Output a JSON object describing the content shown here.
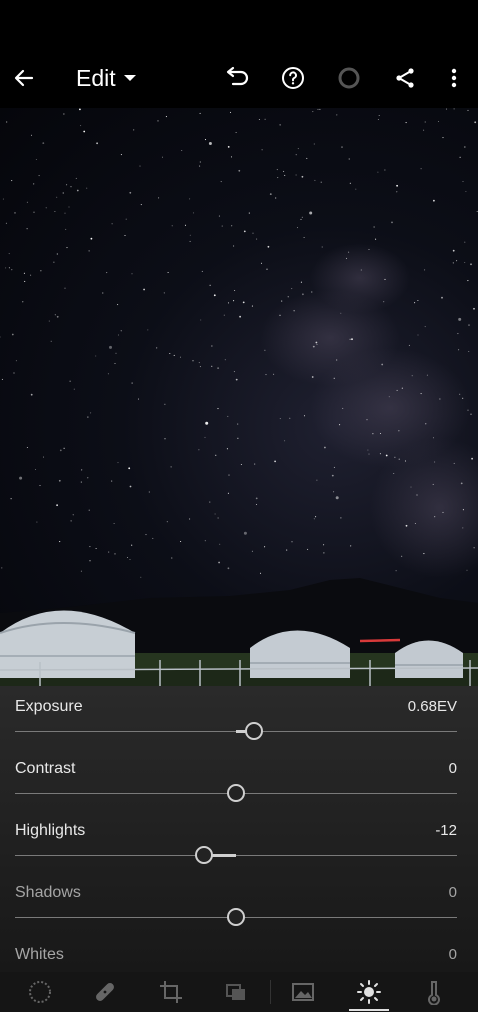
{
  "header": {
    "title": "Edit",
    "icons": [
      "back-arrow-icon",
      "undo-icon",
      "help-icon",
      "status-circle-icon",
      "share-icon",
      "more-vertical-icon"
    ]
  },
  "adjustments": [
    {
      "label": "Exposure",
      "value": "0.68EV",
      "level": 0.068
    },
    {
      "label": "Contrast",
      "value": "0",
      "level": 0
    },
    {
      "label": "Highlights",
      "value": "-12",
      "level": -0.12
    },
    {
      "label": "Shadows",
      "value": "0",
      "level": 0
    },
    {
      "label": "Whites",
      "value": "0",
      "level": 0
    }
  ],
  "toolbar": {
    "icons": [
      "presets-icon",
      "healing-icon",
      "crop-icon",
      "layers-icon",
      "profile-icon",
      "light-icon",
      "color-temperature-icon"
    ],
    "active": "light-icon"
  },
  "colors": {
    "background": "#000000",
    "panel": "#222222",
    "text": "#e8e8e8"
  }
}
